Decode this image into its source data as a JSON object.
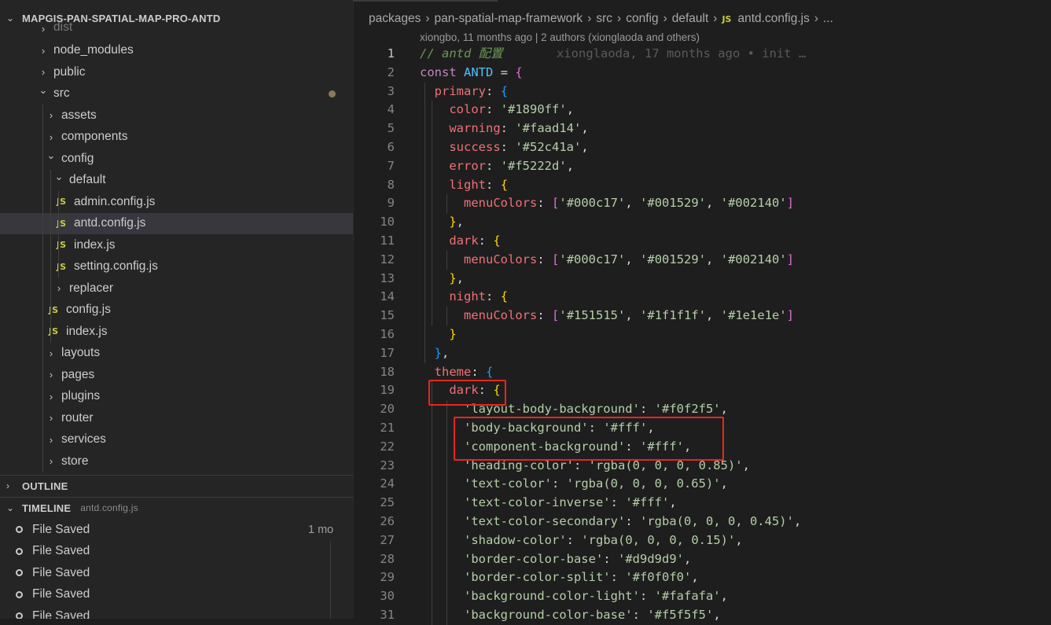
{
  "explorer": {
    "title": "MAPGIS-PAN-SPATIAL-MAP-PRO-ANTD",
    "items": [
      {
        "label": "dist",
        "type": "folder",
        "depth": 1,
        "expanded": false
      },
      {
        "label": "node_modules",
        "type": "folder",
        "depth": 1,
        "expanded": false
      },
      {
        "label": "public",
        "type": "folder",
        "depth": 1,
        "expanded": false
      },
      {
        "label": "src",
        "type": "folder",
        "depth": 1,
        "expanded": true
      },
      {
        "label": "assets",
        "type": "folder",
        "depth": 2,
        "expanded": false
      },
      {
        "label": "components",
        "type": "folder",
        "depth": 2,
        "expanded": false
      },
      {
        "label": "config",
        "type": "folder",
        "depth": 2,
        "expanded": true
      },
      {
        "label": "default",
        "type": "folder",
        "depth": 3,
        "expanded": true
      },
      {
        "label": "admin.config.js",
        "type": "js",
        "depth": 4
      },
      {
        "label": "antd.config.js",
        "type": "js",
        "depth": 4,
        "selected": true
      },
      {
        "label": "index.js",
        "type": "js",
        "depth": 4
      },
      {
        "label": "setting.config.js",
        "type": "js",
        "depth": 4
      },
      {
        "label": "replacer",
        "type": "folder",
        "depth": 3,
        "expanded": false
      },
      {
        "label": "config.js",
        "type": "js",
        "depth": 3
      },
      {
        "label": "index.js",
        "type": "js",
        "depth": 3
      },
      {
        "label": "layouts",
        "type": "folder",
        "depth": 2,
        "expanded": false
      },
      {
        "label": "pages",
        "type": "folder",
        "depth": 2,
        "expanded": false
      },
      {
        "label": "plugins",
        "type": "folder",
        "depth": 2,
        "expanded": false
      },
      {
        "label": "router",
        "type": "folder",
        "depth": 2,
        "expanded": false
      },
      {
        "label": "services",
        "type": "folder",
        "depth": 2,
        "expanded": false
      },
      {
        "label": "store",
        "type": "folder",
        "depth": 2,
        "expanded": false
      }
    ]
  },
  "outline": {
    "title": "OUTLINE"
  },
  "timeline": {
    "title": "TIMELINE",
    "file": "antd.config.js",
    "entries": [
      {
        "label": "File Saved",
        "meta": "1 mo"
      },
      {
        "label": "File Saved",
        "meta": ""
      },
      {
        "label": "File Saved",
        "meta": ""
      },
      {
        "label": "File Saved",
        "meta": ""
      },
      {
        "label": "File Saved",
        "meta": ""
      }
    ]
  },
  "breadcrumb": {
    "parts": [
      "packages",
      "pan-spatial-map-framework",
      "src",
      "config",
      "default"
    ],
    "file_icon": "JS",
    "file": "antd.config.js",
    "ellipsis": "..."
  },
  "codelens": {
    "author": "xiongbo, 11 months ago | 2 authors (xionglaoda and others)"
  },
  "blame": "xionglaoda, 17 months ago • init …",
  "code_lines": [
    "// antd 配置",
    "const ANTD = {",
    "  primary: {",
    "    color: '#1890ff',",
    "    warning: '#faad14',",
    "    success: '#52c41a',",
    "    error: '#f5222d',",
    "    light: {",
    "      menuColors: ['#000c17', '#001529', '#002140']",
    "    },",
    "    dark: {",
    "      menuColors: ['#000c17', '#001529', '#002140']",
    "    },",
    "    night: {",
    "      menuColors: ['#151515', '#1f1f1f', '#1e1e1e']",
    "    }",
    "  },",
    "  theme: {",
    "    dark: {",
    "      'layout-body-background': '#f0f2f5',",
    "      'body-background': '#fff',",
    "      'component-background': '#fff',",
    "      'heading-color': 'rgba(0, 0, 0, 0.85)',",
    "      'text-color': 'rgba(0, 0, 0, 0.65)',",
    "      'text-color-inverse': '#fff',",
    "      'text-color-secondary': 'rgba(0, 0, 0, 0.45)',",
    "      'shadow-color': 'rgba(0, 0, 0, 0.15)',",
    "      'border-color-base': '#d9d9d9',",
    "      'border-color-split': '#f0f0f0',",
    "      'background-color-light': '#fafafa',",
    "      'background-color-base': '#f5f5f5',"
  ],
  "colors": {
    "highlight_box": "#e8261f",
    "js_icon": "#cbcb41"
  }
}
